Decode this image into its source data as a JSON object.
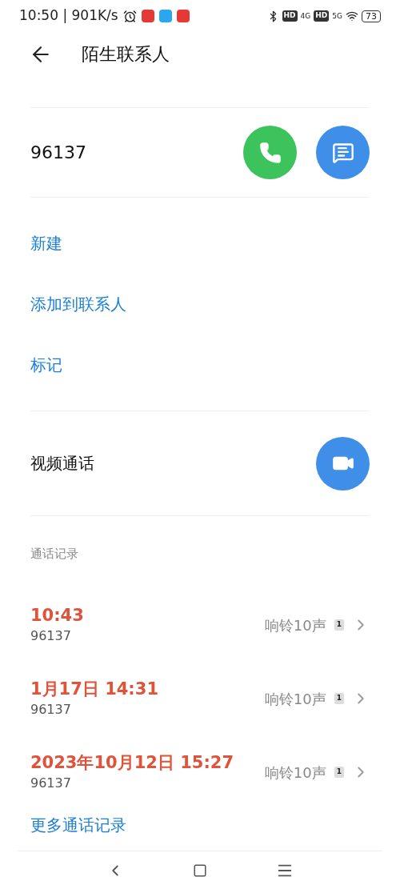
{
  "status_bar": {
    "time": "10:50 | 901K/s",
    "badges": [
      "HD",
      "4G",
      "HD",
      "5G"
    ],
    "battery": "73"
  },
  "header": {
    "title": "陌生联系人"
  },
  "number": "96137",
  "actions": [
    "新建",
    "添加到联系人",
    "标记"
  ],
  "video_call": {
    "label": "视频通话"
  },
  "call_log": {
    "heading": "通话记录",
    "entries": [
      {
        "time": "10:43",
        "number": "96137",
        "status": "响铃10声",
        "sim": "1"
      },
      {
        "time": "1月17日 14:31",
        "number": "96137",
        "status": "响铃10声",
        "sim": "1"
      },
      {
        "time": "2023年10月12日 15:27",
        "number": "96137",
        "status": "响铃10声",
        "sim": "1"
      }
    ],
    "more": "更多通话记录"
  }
}
